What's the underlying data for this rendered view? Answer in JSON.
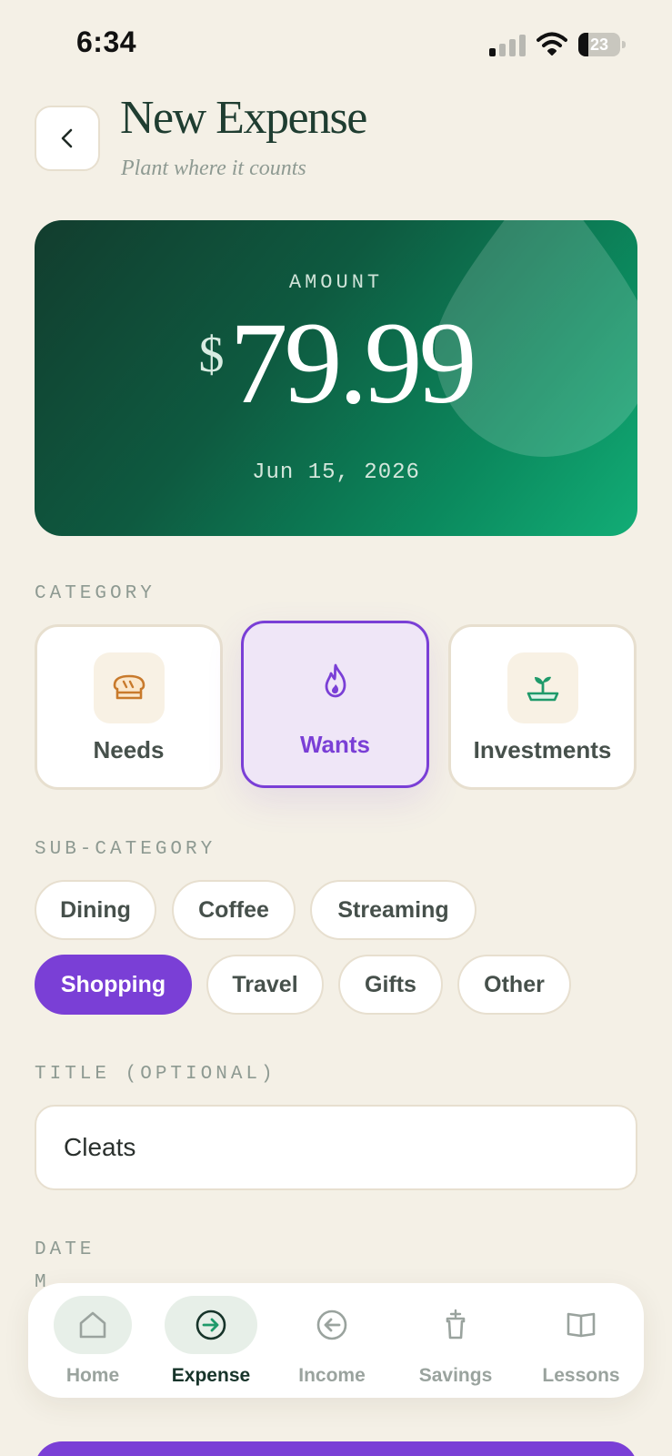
{
  "status": {
    "time": "6:34",
    "battery": "23",
    "battery_level": 0.23
  },
  "header": {
    "title": "New Expense",
    "subtitle": "Plant where it counts"
  },
  "amount": {
    "label": "AMOUNT",
    "currency": "$",
    "value": "79.99",
    "date": "Jun 15, 2026"
  },
  "category": {
    "label": "CATEGORY",
    "items": [
      {
        "label": "Needs",
        "icon": "bread-icon",
        "selected": false
      },
      {
        "label": "Wants",
        "icon": "flame-icon",
        "selected": true
      },
      {
        "label": "Investments",
        "icon": "sprout-icon",
        "selected": false
      }
    ]
  },
  "subcategory": {
    "label": "SUB-CATEGORY",
    "items": [
      "Dining",
      "Coffee",
      "Streaming",
      "Shopping",
      "Travel",
      "Gifts",
      "Other"
    ],
    "selected": "Shopping"
  },
  "title_field": {
    "label": "TITLE (OPTIONAL)",
    "value": "Cleats"
  },
  "date_field": {
    "label": "DATE",
    "partial_text": "M"
  },
  "nav": {
    "items": [
      {
        "label": "Home",
        "icon": "home-icon"
      },
      {
        "label": "Expense",
        "icon": "arrow-right-circle-icon",
        "active": true
      },
      {
        "label": "Income",
        "icon": "arrow-left-circle-icon"
      },
      {
        "label": "Savings",
        "icon": "jar-icon"
      },
      {
        "label": "Lessons",
        "icon": "book-icon"
      }
    ]
  },
  "colors": {
    "background": "#f4f0e6",
    "accent": "#7a3fd6",
    "green_dark": "#123d2e",
    "green_light": "#12ad76"
  }
}
